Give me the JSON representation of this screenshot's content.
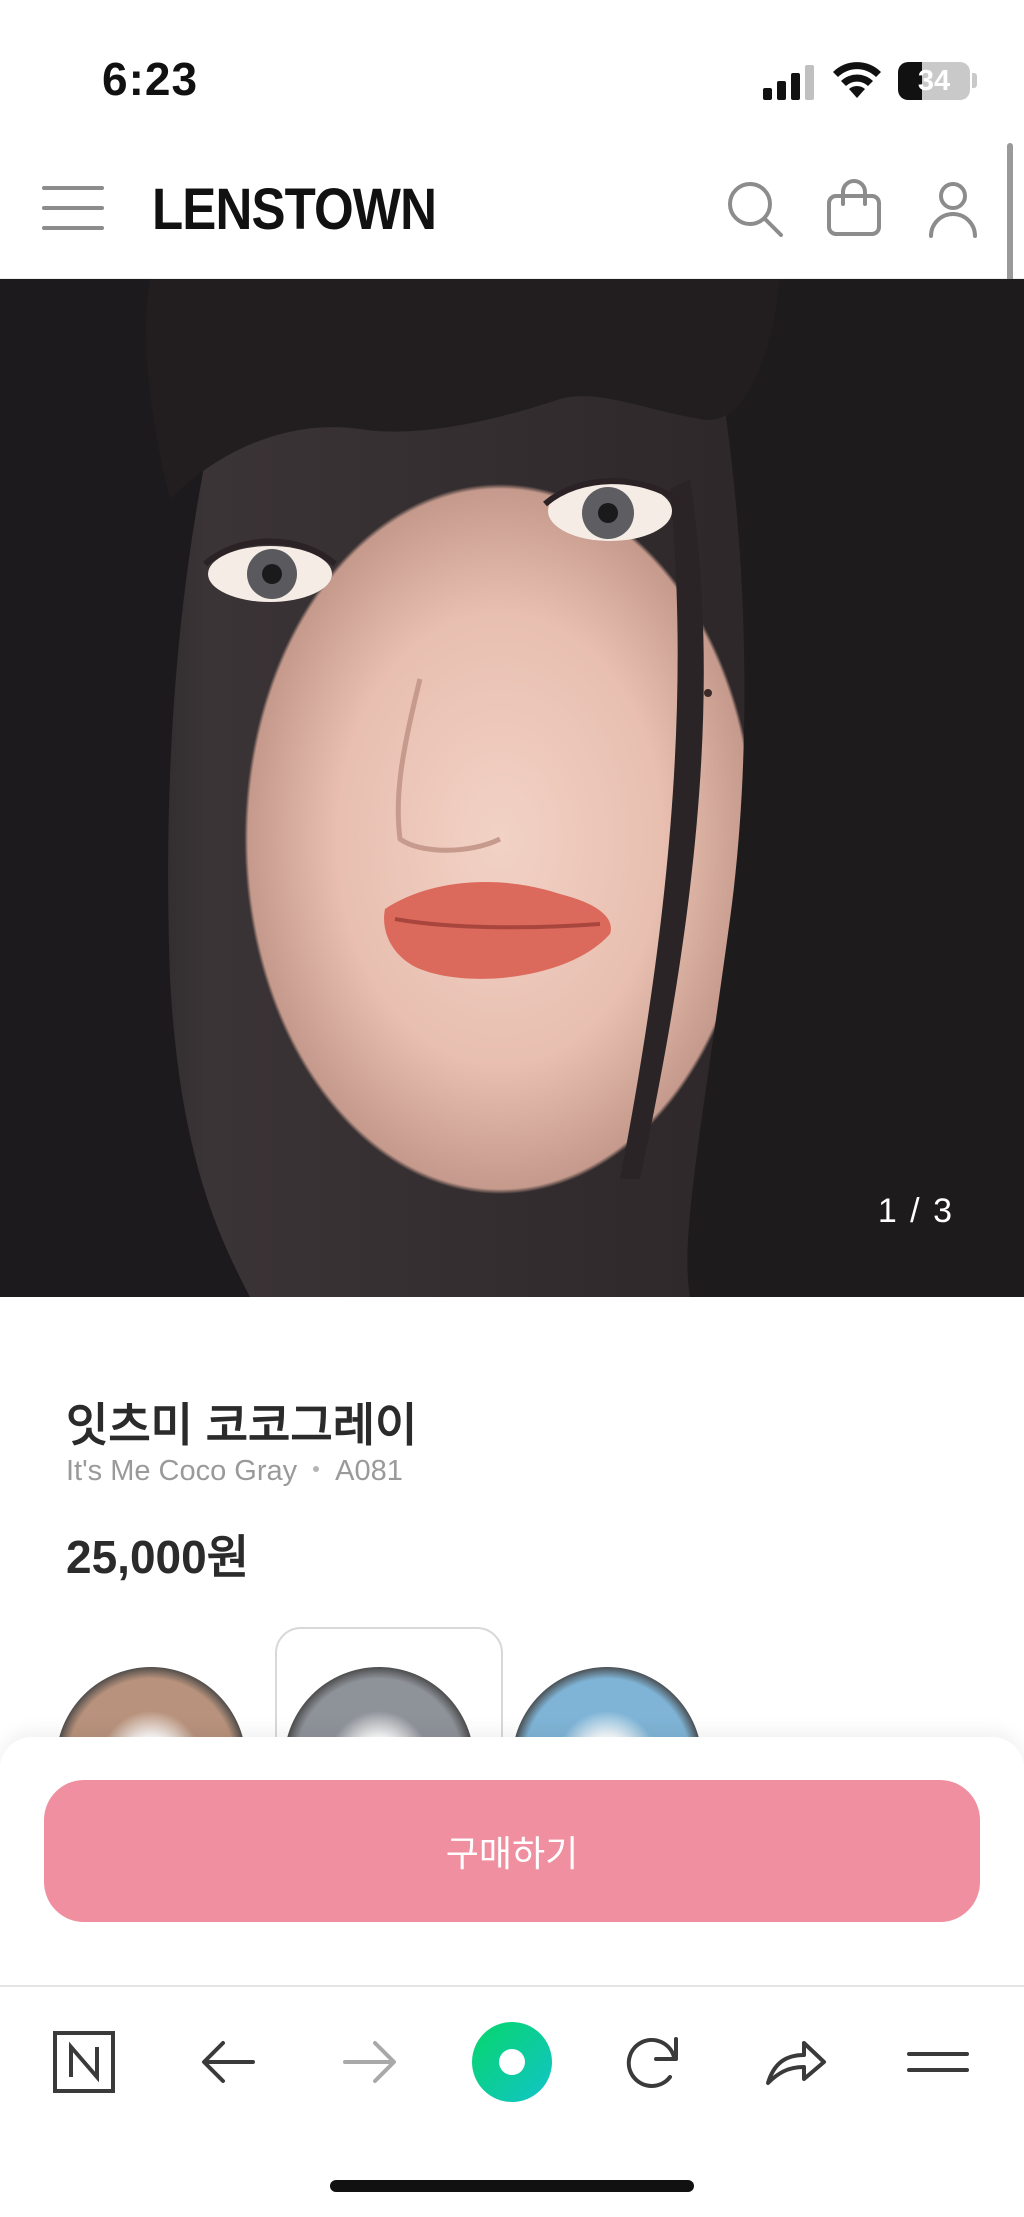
{
  "status_bar": {
    "time": "6:23",
    "battery": "34",
    "battery_level": 0.34
  },
  "header": {
    "brand": "LENSTOWN",
    "icons": [
      "hamburger-menu-icon",
      "search-icon",
      "shopping-bag-icon",
      "user-icon"
    ]
  },
  "hero": {
    "counter": "1 / 3"
  },
  "product": {
    "name": "잇츠미 코코그레이",
    "english_name": "It's Me Coco Gray",
    "code": "A081",
    "price": "25,000원",
    "swatches": [
      {
        "color": "#b8927c",
        "selected": false
      },
      {
        "color": "#8e9299",
        "selected": true
      },
      {
        "color": "#7fb4d6",
        "selected": false
      }
    ]
  },
  "buy": {
    "label": "구매하기",
    "color": "#ef8fa0"
  },
  "browser_bar": {
    "icons": [
      "naver-n-icon",
      "back-arrow-icon",
      "forward-arrow-icon",
      "green-home-icon",
      "reload-icon",
      "share-icon",
      "menu-icon"
    ]
  }
}
